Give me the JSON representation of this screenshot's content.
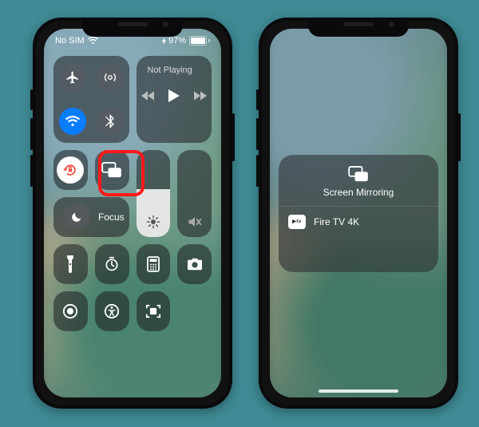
{
  "status": {
    "carrier": "No SIM",
    "battery_pct": "97%"
  },
  "media": {
    "title": "Not Playing"
  },
  "focus": {
    "label": "Focus"
  },
  "brightness": {
    "level_pct": 55
  },
  "volume": {
    "level_pct": 0
  },
  "highlight": {
    "target": "screen-mirroring-button"
  },
  "mirroring": {
    "title": "Screen Mirroring",
    "devices": [
      {
        "badge": "tv",
        "name": "Fire TV 4K"
      }
    ]
  },
  "icons": {
    "airplane": "airplane-icon",
    "airdrop": "airdrop-icon",
    "wifi": "wifi-icon",
    "bluetooth": "bluetooth-icon",
    "lock": "rotation-lock-icon",
    "mirror": "screen-mirroring-icon",
    "moon": "moon-icon",
    "sun": "brightness-icon",
    "speaker_mute": "speaker-mute-icon",
    "torch": "flashlight-icon",
    "timer": "timer-icon",
    "calc": "calculator-icon",
    "camera": "camera-icon",
    "access": "accessibility-icon",
    "scan": "code-scanner-icon",
    "prev": "prev-track-icon",
    "play": "play-icon",
    "next": "next-track-icon"
  }
}
